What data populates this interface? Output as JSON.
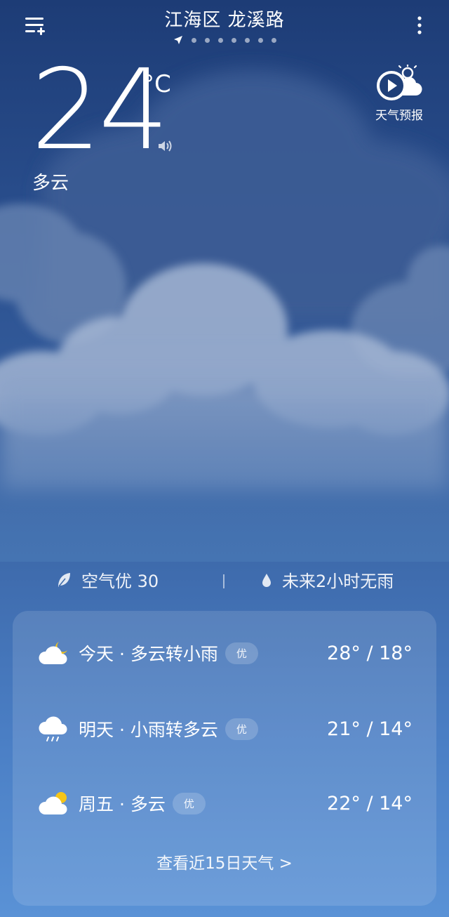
{
  "header": {
    "location": "江海区 龙溪路",
    "page_dots": 7
  },
  "current": {
    "temperature": "24",
    "unit": "°C",
    "condition": "多云"
  },
  "forecast_button": {
    "label": "天气预报"
  },
  "air": {
    "quality": "空气优 30",
    "rain": "未来2小时无雨"
  },
  "daily": [
    {
      "label": "今天 · 多云转小雨",
      "aqi": "优",
      "temps": "28° / 18°",
      "icon": "cloudy-moon-icon"
    },
    {
      "label": "明天 · 小雨转多云",
      "aqi": "优",
      "temps": "21° / 14°",
      "icon": "light-rain-icon"
    },
    {
      "label": "周五 · 多云",
      "aqi": "优",
      "temps": "22° / 14°",
      "icon": "partly-cloudy-icon"
    }
  ],
  "more_link": "查看近15日天气  >",
  "colors": {
    "bg_top": "#1d3c76",
    "bg_bottom": "#5a92d6",
    "sun": "#f5c518"
  }
}
